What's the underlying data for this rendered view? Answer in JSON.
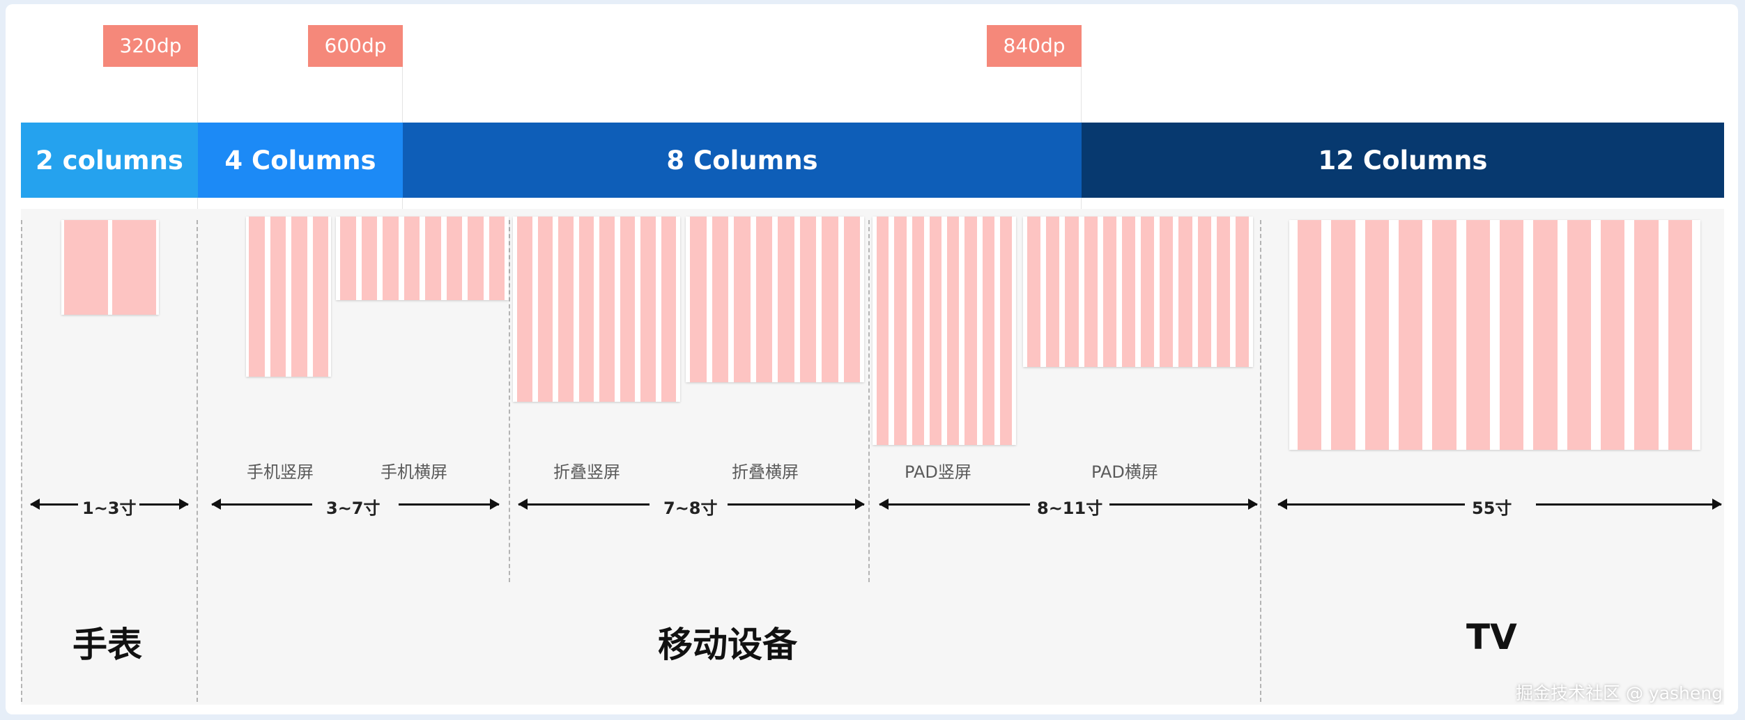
{
  "breakpoints": [
    {
      "label": "320dp"
    },
    {
      "label": "600dp"
    },
    {
      "label": "840dp"
    }
  ],
  "bands": [
    {
      "label": "2 columns",
      "color": "#25a2ee"
    },
    {
      "label": "4 Columns",
      "color": "#1c8af6"
    },
    {
      "label": "8 Columns",
      "color": "#0e5eb8"
    },
    {
      "label": "12 Columns",
      "color": "#07396f"
    }
  ],
  "devices": [
    {
      "label": "",
      "columns": 2
    },
    {
      "label": "手机竖屏",
      "columns": 4
    },
    {
      "label": "手机横屏",
      "columns": 8
    },
    {
      "label": "折叠竖屏",
      "columns": 8
    },
    {
      "label": "折叠横屏",
      "columns": 8
    },
    {
      "label": "PAD竖屏",
      "columns": 8
    },
    {
      "label": "PAD横屏",
      "columns": 12
    },
    {
      "label": "",
      "columns": 12
    }
  ],
  "sizes": [
    {
      "label": "1~3寸"
    },
    {
      "label": "3~7寸"
    },
    {
      "label": "7~8寸"
    },
    {
      "label": "8~11寸"
    },
    {
      "label": "55寸"
    }
  ],
  "categories": [
    {
      "label": "手表"
    },
    {
      "label": "移动设备"
    },
    {
      "label": "TV"
    }
  ],
  "watermark": "掘金技术社区 @ yasheng",
  "colors": {
    "breakpoint_tag": "#f5887a",
    "column_fill": "#fdc4c2",
    "panel_bg": "#f6f6f6"
  }
}
